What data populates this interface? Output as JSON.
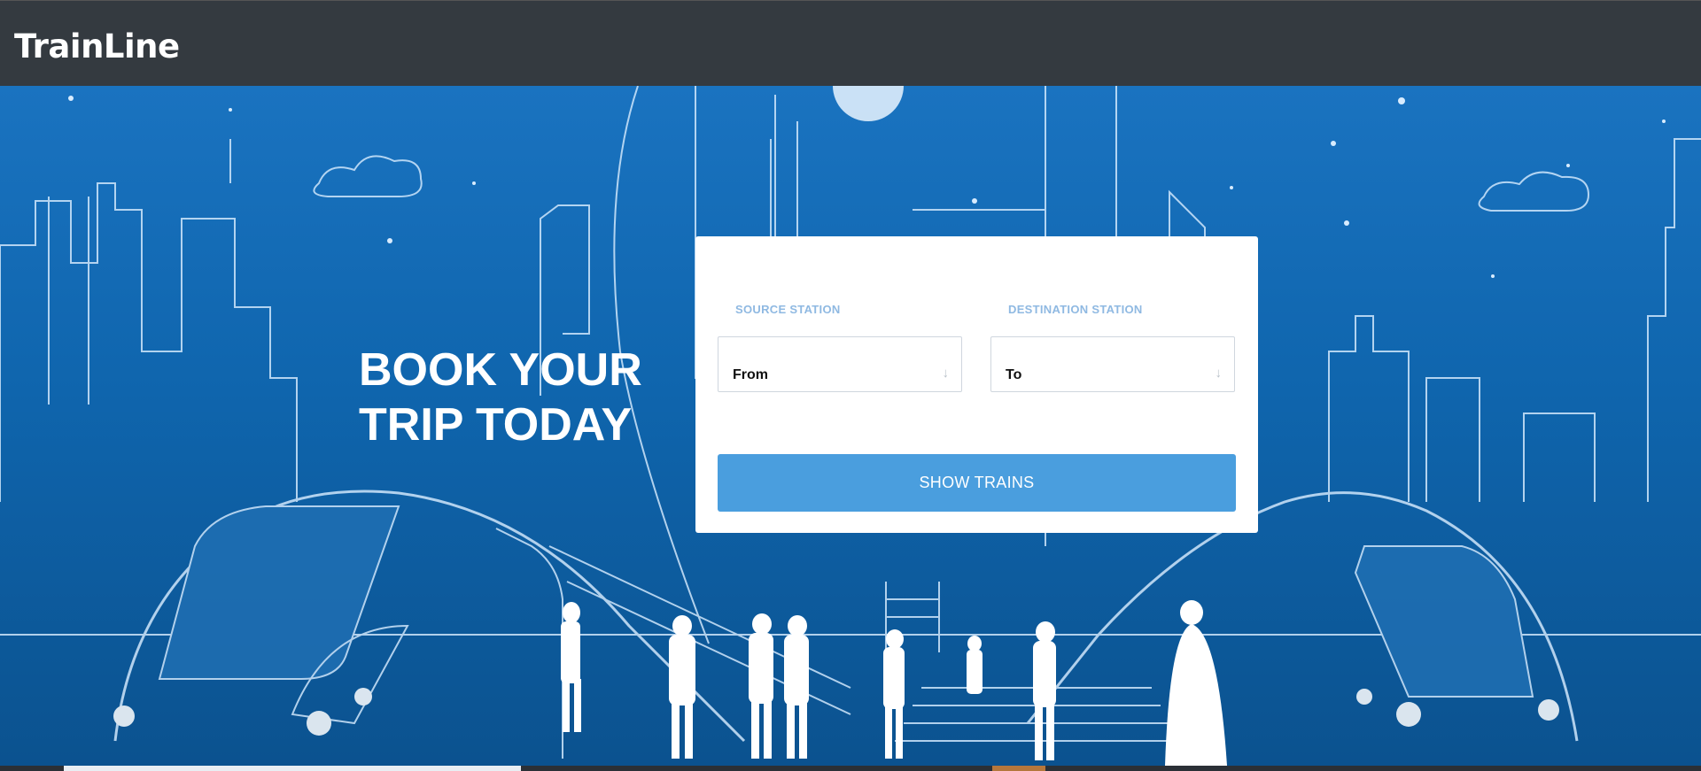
{
  "brand": "TrainLine",
  "hero": {
    "headline_line1": "BOOK YOUR",
    "headline_line2": "TRIP TODAY"
  },
  "form": {
    "source_label": "SOURCE STATION",
    "source_value": "From",
    "destination_label": "DESTINATION STATION",
    "destination_value": "To",
    "submit_label": "SHOW TRAINS",
    "arrow_icon": "↓"
  },
  "colors": {
    "navbar": "#343a40",
    "hero_blue": "#1a73c0",
    "button": "#4a9ede",
    "label": "#8fb9e2"
  }
}
